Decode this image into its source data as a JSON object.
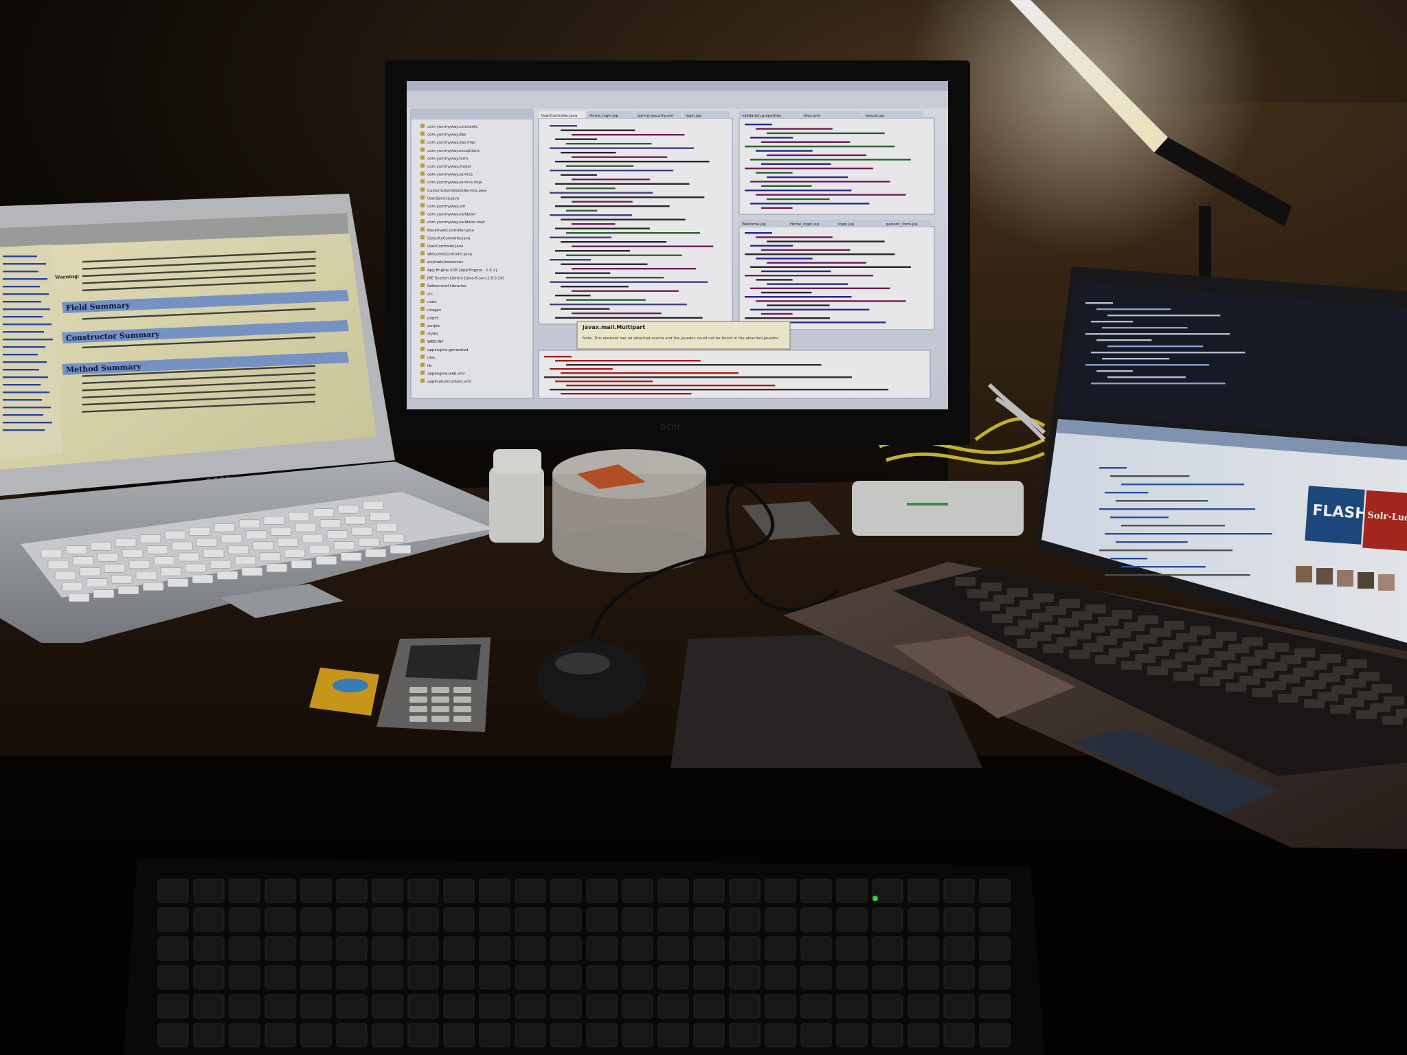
{
  "photo": {
    "colors": {
      "wall": "#3a2a1a",
      "desk": "#1e140c",
      "shadow": "#050403",
      "lamp_light": "#fffbe6"
    }
  },
  "left_laptop": {
    "brand": "acer",
    "screen": {
      "section_headers": [
        "Field Summary",
        "Constructor Summary",
        "Method Summary"
      ],
      "warning_label": "Warning:"
    }
  },
  "center_monitor": {
    "brand": "acer",
    "eclipse": {
      "tabs": [
        "UserController.java",
        "Home_login.jsp",
        "spring-security.xml",
        "login.jsp"
      ],
      "right_tabs": [
        "validation.properties",
        "tiles.xml",
        "layout.jsp"
      ],
      "bottom_tabs": [
        "Welcome.jsp",
        "Home_login.jsp",
        "login.jsp",
        "generic_form.jsp"
      ],
      "tooltip_title": "javax.mail.Multipart",
      "tooltip_text": "Note: This element has no attached source and the Javadoc could not be found in the attached Javadoc.",
      "tree_items": [
        "com.yummyway.constants",
        "com.yummyway.dao",
        "com.yummyway.dao.impl",
        "com.yummyway.exceptions",
        "com.yummyway.form",
        "com.yummyway.model",
        "com.yummyway.service",
        "com.yummyway.service.impl",
        "CustomUserDetailsService.java",
        "UserService.java",
        "com.yummyway.util",
        "com.yummyway.validator",
        "com.yummyway.validator.impl",
        "BookmarkController.java",
        "SecurityController.java",
        "UserController.java",
        "WelcomeController.java",
        "src/main/resources",
        "App Engine SDK [App Engine - 1.6.2]",
        "JRE System Library [java-6-sun-1.6.0.24]",
        "Referenced Libraries",
        "src",
        "main",
        "images",
        "pages",
        "scripts",
        "styles",
        "WEB-INF",
        "appengine-generated",
        "tiles",
        "lib",
        "appengine-web.xml",
        "applicationContext.xml"
      ]
    }
  },
  "right_laptop": {
    "screen": {
      "badge_flash": "FLASH",
      "badge_solr": "Solr-Lucene"
    }
  },
  "desk_items": {
    "spindle_label": "",
    "phone": "",
    "card": ""
  }
}
